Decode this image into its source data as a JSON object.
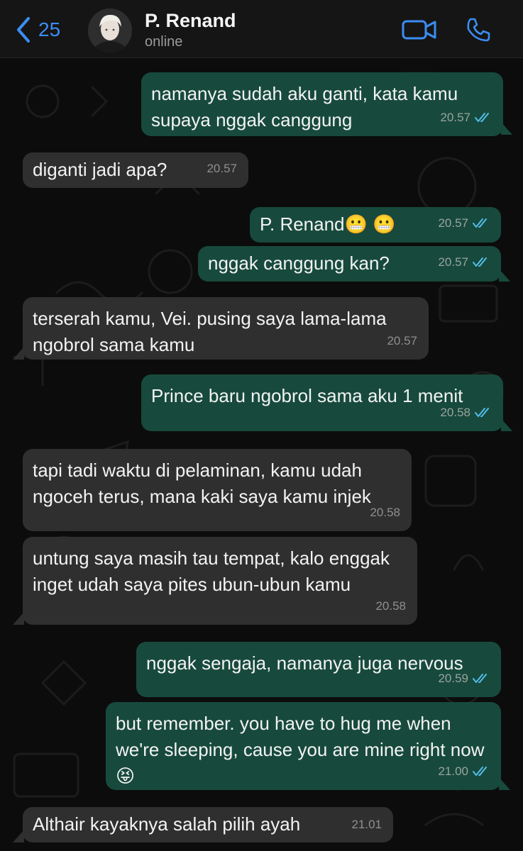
{
  "header": {
    "back_count": "25",
    "contact_name": "P. Renand",
    "status": "online"
  },
  "colors": {
    "accent": "#3b8df2",
    "outgoing_bubble": "#174a3c",
    "incoming_bubble": "#2f2f2f",
    "read_ticks": "#53bdeb",
    "background": "#0c0c0c"
  },
  "messages": [
    {
      "direction": "outgoing",
      "text": "namanya sudah aku ganti, kata kamu supaya nggak canggung",
      "time": "20.57",
      "read": true
    },
    {
      "direction": "incoming",
      "text": "diganti jadi apa?",
      "time": "20.57"
    },
    {
      "direction": "outgoing",
      "text": "P. Renand😬 😬",
      "time": "20.57",
      "read": true
    },
    {
      "direction": "outgoing",
      "text": "nggak canggung kan?",
      "time": "20.57",
      "read": true
    },
    {
      "direction": "incoming",
      "text": "terserah kamu, Vei. pusing saya lama-lama ngobrol sama kamu",
      "time": "20.57"
    },
    {
      "direction": "outgoing",
      "text": "Prince baru ngobrol sama aku 1 menit",
      "time": "20.58",
      "read": true
    },
    {
      "direction": "incoming",
      "text": "tapi tadi waktu di pelaminan, kamu udah ngoceh terus, mana kaki saya kamu injek",
      "time": "20.58"
    },
    {
      "direction": "incoming",
      "text": "untung saya masih tau tempat, kalo enggak inget udah saya pites ubun-ubun kamu",
      "time": "20.58"
    },
    {
      "direction": "outgoing",
      "text": "nggak sengaja, namanya juga nervous",
      "time": "20.59",
      "read": true
    },
    {
      "direction": "outgoing",
      "text": "but remember. you have to hug me when we're sleeping, cause you are mine right now😝",
      "time": "21.00",
      "read": true
    },
    {
      "direction": "incoming",
      "text": "Althair kayaknya salah pilih ayah",
      "time": "21.01"
    }
  ]
}
